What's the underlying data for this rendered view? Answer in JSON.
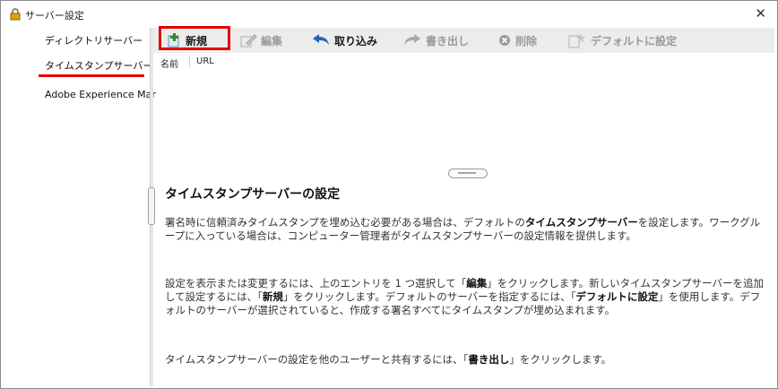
{
  "window": {
    "title": "サーバー設定",
    "close_label": "✕"
  },
  "sidebar": {
    "items": [
      {
        "label": "ディレクトリサーバー"
      },
      {
        "label": "タイムスタンプサーバー",
        "selected": true
      },
      {
        "label": "Adobe Experience Mar"
      }
    ]
  },
  "toolbar": {
    "new_label": "新規",
    "edit_label": "編集",
    "import_label": "取り込み",
    "export_label": "書き出し",
    "delete_label": "削除",
    "default_label": "デフォルトに設定"
  },
  "list": {
    "col_name": "名前",
    "col_url": "URL"
  },
  "help": {
    "heading": "タイムスタンプサーバーの設定",
    "p1_a": "署名時に信頼済みタイムスタンプを埋め込む必要がある場合は、デフォルトの",
    "p1_b": "タイムスタンプサーバー",
    "p1_c": "を設定します。ワークグループに入っている場合は、コンピューター管理者がタイムスタンプサーバーの設定情報を提供します。",
    "p2_a": "設定を表示または変更するには、上のエントリを 1 つ選択して「",
    "p2_b": "編集",
    "p2_c": "」をクリックします。新しいタイムスタンプサーバーを追加して設定するには、「",
    "p2_d": "新規",
    "p2_e": "」をクリックします。デフォルトのサーバーを指定するには、「",
    "p2_f": "デフォルトに設定",
    "p2_g": "」を使用します。デフォルトのサーバーが選択されていると、作成する署名すべてにタイムスタンプが埋め込まれます。",
    "p3_a": "タイムスタンプサーバーの設定を他のユーザーと共有するには、「",
    "p3_b": "書き出し",
    "p3_c": "」をクリックします。"
  },
  "colors": {
    "highlight": "#e00000",
    "toolbar_bg": "#ececec",
    "disabled": "#9a9a9a"
  }
}
